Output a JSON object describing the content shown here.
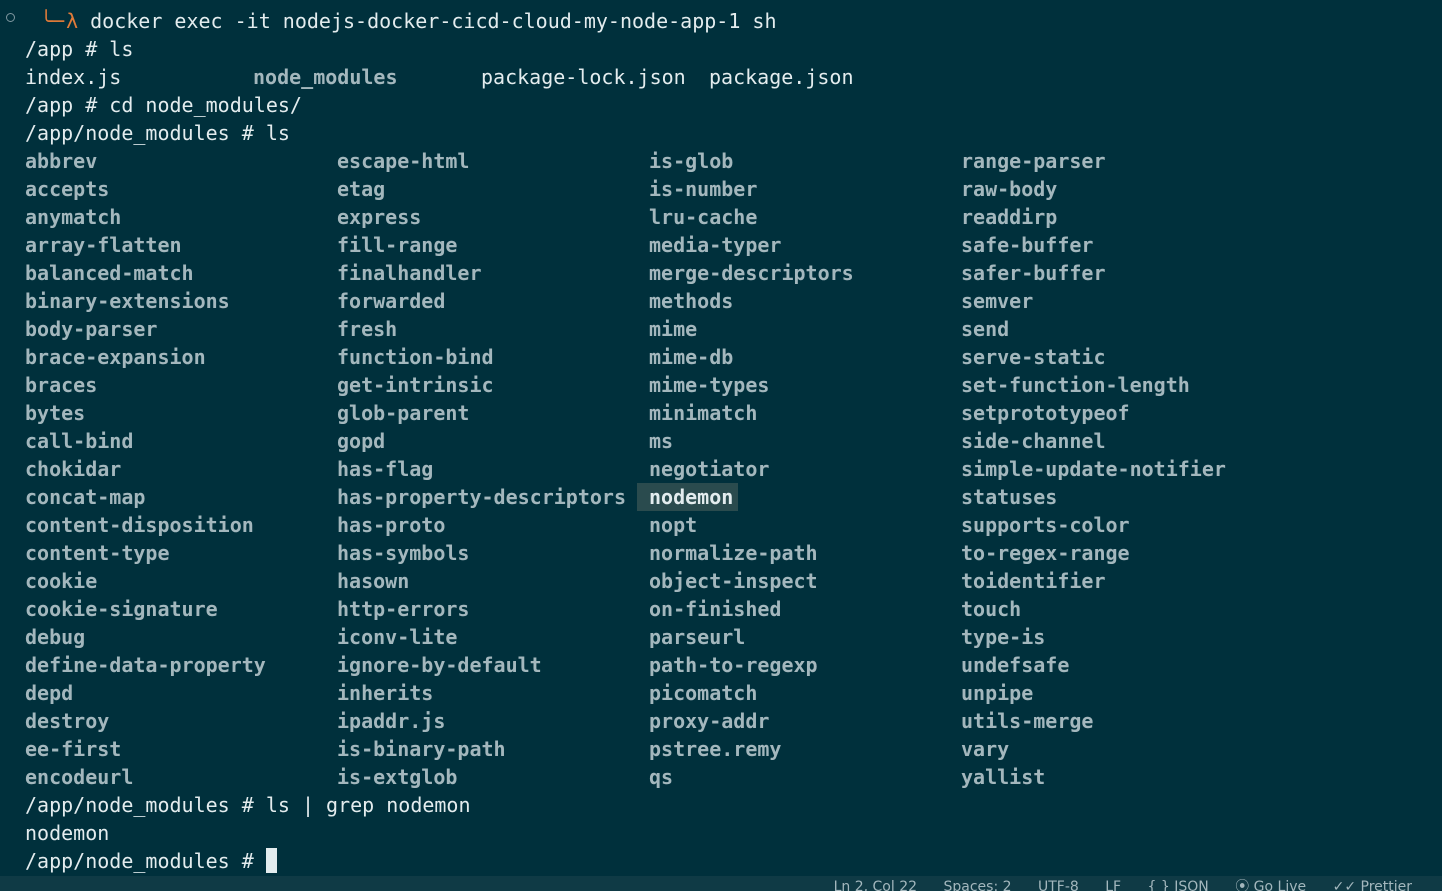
{
  "terminal": {
    "first_command": "docker exec -it nodejs-docker-cicd-cloud-my-node-app-1 sh",
    "prompt_lambda": "λ",
    "line2": "/app # ls",
    "files": [
      "index.js",
      "node_modules",
      "package-lock.json",
      "package.json"
    ],
    "line4": "/app # cd node_modules/",
    "line5": "/app/node_modules # ls",
    "columns": [
      [
        "abbrev",
        "accepts",
        "anymatch",
        "array-flatten",
        "balanced-match",
        "binary-extensions",
        "body-parser",
        "brace-expansion",
        "braces",
        "bytes",
        "call-bind",
        "chokidar",
        "concat-map",
        "content-disposition",
        "content-type",
        "cookie",
        "cookie-signature",
        "debug",
        "define-data-property",
        "depd",
        "destroy",
        "ee-first",
        "encodeurl"
      ],
      [
        "escape-html",
        "etag",
        "express",
        "fill-range",
        "finalhandler",
        "forwarded",
        "fresh",
        "function-bind",
        "get-intrinsic",
        "glob-parent",
        "gopd",
        "has-flag",
        "has-property-descriptors",
        "has-proto",
        "has-symbols",
        "hasown",
        "http-errors",
        "iconv-lite",
        "ignore-by-default",
        "inherits",
        "ipaddr.js",
        "is-binary-path",
        "is-extglob"
      ],
      [
        "is-glob",
        "is-number",
        "lru-cache",
        "media-typer",
        "merge-descriptors",
        "methods",
        "mime",
        "mime-db",
        "mime-types",
        "minimatch",
        "ms",
        "negotiator",
        "nodemon",
        "nopt",
        "normalize-path",
        "object-inspect",
        "on-finished",
        "parseurl",
        "path-to-regexp",
        "picomatch",
        "proxy-addr",
        "pstree.remy",
        "qs"
      ],
      [
        "range-parser",
        "raw-body",
        "readdirp",
        "safe-buffer",
        "safer-buffer",
        "semver",
        "send",
        "serve-static",
        "set-function-length",
        "setprototypeof",
        "side-channel",
        "simple-update-notifier",
        "statuses",
        "supports-color",
        "to-regex-range",
        "toidentifier",
        "touch",
        "type-is",
        "undefsafe",
        "unpipe",
        "utils-merge",
        "vary",
        "yallist"
      ]
    ],
    "highlighted": "nodemon",
    "grep_command": "/app/node_modules # ls | grep nodemon",
    "grep_result": "nodemon",
    "final_prompt": "/app/node_modules # "
  },
  "statusbar": {
    "position": "Ln 2, Col 22",
    "spaces": "Spaces: 2",
    "encoding": "UTF-8",
    "eol": "LF",
    "language": "{ } JSON",
    "golive": "⦿ Go Live",
    "prettier": "✓✓ Prettier"
  },
  "colors": {
    "background": "#00303c",
    "text": "#e3ecee",
    "directory": "#a3b7bd",
    "accent": "#e07b39",
    "highlight_bg": "#2a4b4e"
  }
}
